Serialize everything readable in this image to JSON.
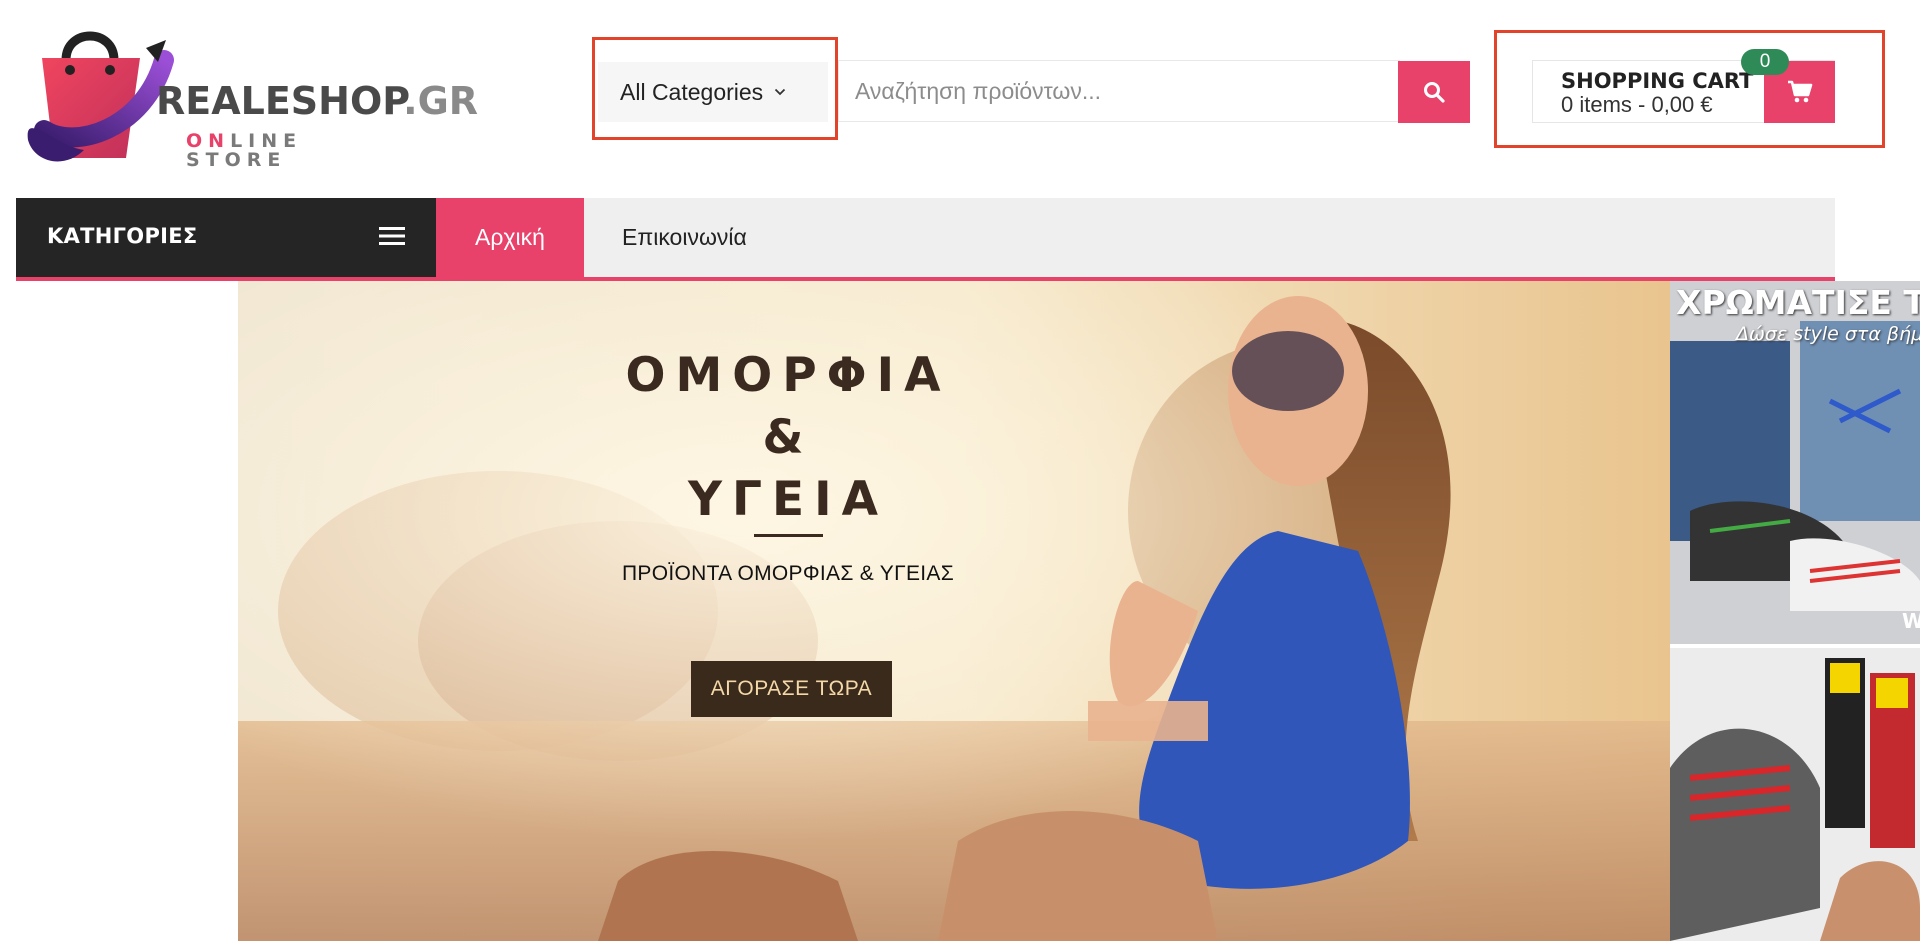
{
  "brand": {
    "logo_main": "REALESHOP",
    "logo_tld": ".GR",
    "logo_tagline_accent": "ON",
    "logo_tagline_rest": "LINE STORE"
  },
  "search": {
    "category_selected": "All Categories",
    "placeholder": "Αναζήτηση προϊόντων..."
  },
  "cart": {
    "title": "SHOPPING CART",
    "summary": "0 items - 0,00 €",
    "badge_count": "0"
  },
  "nav": {
    "categories_label": "ΚΑΤΗΓΟΡΙΕΣ",
    "items": [
      {
        "label": "Αρχική",
        "active": true
      },
      {
        "label": "Επικοινωνία",
        "active": false
      }
    ]
  },
  "hero": {
    "title_lines": [
      "ΟΜΟΡΦΙΑ",
      "&",
      "ΥΓΕΙΑ"
    ],
    "subtitle": "ΠΡΟΪΟΝΤΑ ΟΜΟΡΦΙΑΣ & ΥΓΕΙΑΣ",
    "cta": "ΑΓΟΡΑΣΕ ΤΩΡΑ"
  },
  "side_banner": {
    "headline": "ΧΡΩΜΑΤΙΣΕ ΤΗ Ζ",
    "tagline": "Δώσε style στα βήματ",
    "url_fragment": "WW"
  },
  "colors": {
    "accent": "#e8426b",
    "nav_dark": "#252525",
    "badge": "#2e8b57",
    "highlight": "#e2432b",
    "hero_button": "#3a2a1c"
  },
  "icons": [
    "search-icon",
    "cart-icon",
    "chevron-down-icon",
    "hamburger-icon",
    "shopping-bag-logo-icon"
  ]
}
